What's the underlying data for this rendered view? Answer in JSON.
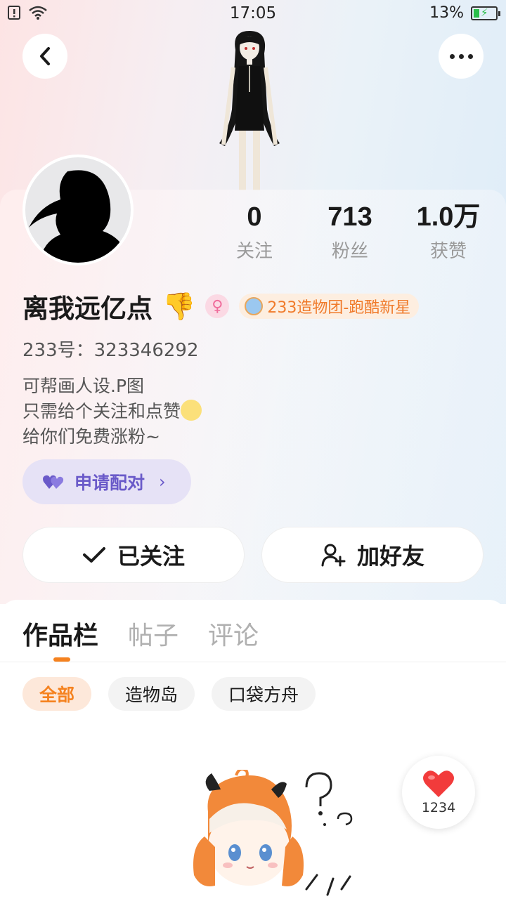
{
  "status_bar": {
    "time": "17:05",
    "battery": "13%"
  },
  "stats": [
    {
      "value": "0",
      "label": "关注"
    },
    {
      "value": "713",
      "label": "粉丝"
    },
    {
      "value": "1.0万",
      "label": "获赞"
    }
  ],
  "profile": {
    "name": "离我远亿点",
    "gender_icon": "♀",
    "tag": "233造物团-跑酷新星",
    "uid": "233号：323346292",
    "bio": [
      "可帮画人设.P图",
      "只需给个关注和点赞",
      "给你们免费涨粉~"
    ]
  },
  "pair_button": {
    "label": "申请配对",
    "chevron": "›"
  },
  "actions": {
    "followed_label": "已关注",
    "add_friend_label": "加好友"
  },
  "tabs": [
    "作品栏",
    "帖子",
    "评论"
  ],
  "chips": [
    "全部",
    "造物岛",
    "口袋方舟"
  ],
  "like_button": {
    "count": "1234"
  },
  "colors": {
    "accent_orange": "#f5821f",
    "pair_purple": "#6a5ac9",
    "like_red": "#f23b3b"
  },
  "icons": {
    "back": "back-arrow-icon",
    "more": "more-dots-icon",
    "check": "check-icon",
    "add_friend": "add-user-icon",
    "heart": "heart-icon",
    "pair": "double-heart-icon"
  }
}
